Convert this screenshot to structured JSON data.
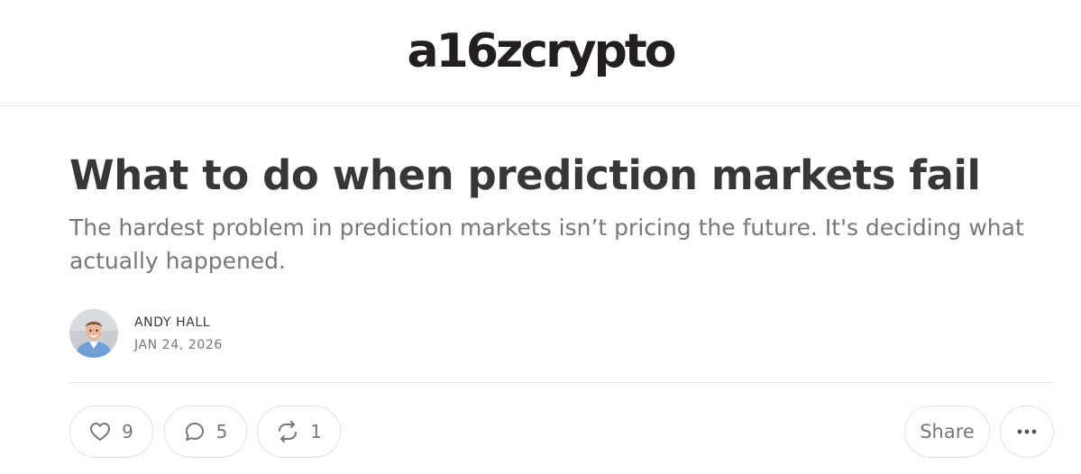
{
  "header": {
    "logo_text": "a16zcrypto"
  },
  "post": {
    "title": "What to do when prediction markets fail",
    "subtitle": "The hardest problem in prediction markets isn’t pricing the future. It's deciding what actually happened.",
    "author": "ANDY HALL",
    "date": "JAN 24, 2026"
  },
  "actions": {
    "likes": "9",
    "comments": "5",
    "restacks": "1",
    "share_label": "Share"
  },
  "icons": [
    "heart-icon",
    "comment-icon",
    "restack-icon",
    "more-icon"
  ],
  "colors": {
    "title": "#363737",
    "subtitle": "#777777",
    "border": "#e0e0e0",
    "logo": "#231f20"
  }
}
